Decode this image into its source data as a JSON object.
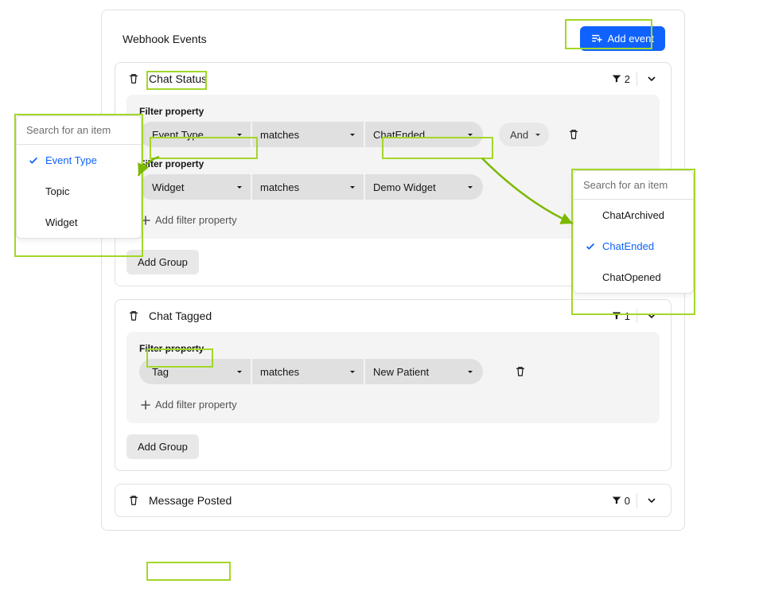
{
  "header": {
    "title": "Webhook Events",
    "add_event_label": "Add event"
  },
  "events": [
    {
      "name": "Chat Status",
      "filter_count": "2",
      "filter_property_label": "Filter property",
      "rows": [
        {
          "property": "Event Type",
          "operator": "matches",
          "value": "ChatEnded",
          "joiner": "And"
        },
        {
          "property": "Widget",
          "operator": "matches",
          "value": "Demo Widget"
        }
      ],
      "add_filter_label": "Add filter property",
      "add_group_label": "Add Group"
    },
    {
      "name": "Chat Tagged",
      "filter_count": "1",
      "filter_property_label": "Filter property",
      "rows": [
        {
          "property": "Tag",
          "operator": "matches",
          "value": "New Patient"
        }
      ],
      "add_filter_label": "Add filter property",
      "add_group_label": "Add Group"
    },
    {
      "name": "Message Posted",
      "filter_count": "0"
    }
  ],
  "popover_left": {
    "search_placeholder": "Search for an item",
    "items": [
      {
        "label": "Event Type",
        "selected": true
      },
      {
        "label": "Topic",
        "selected": false
      },
      {
        "label": "Widget",
        "selected": false
      }
    ]
  },
  "popover_right": {
    "search_placeholder": "Search for an item",
    "items": [
      {
        "label": "ChatArchived",
        "selected": false
      },
      {
        "label": "ChatEnded",
        "selected": true
      },
      {
        "label": "ChatOpened",
        "selected": false
      }
    ]
  }
}
